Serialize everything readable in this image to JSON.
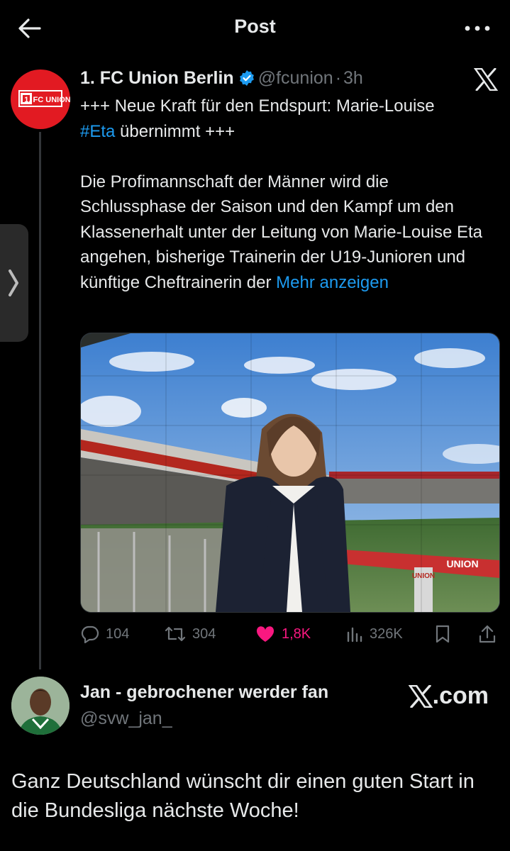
{
  "header": {
    "title": "Post"
  },
  "tweet": {
    "author_name": "1. FC Union Berlin",
    "handle": "@fcunion",
    "separator": "·",
    "time": "3h",
    "line1": "+++ Neue Kraft für den Endspurt: Marie-Louise",
    "hashtag": "#Eta",
    "line2_rest": " übernimmt +++",
    "paragraph": "Die Profimannschaft der Männer wird die Schlussphase der Saison und den Kampf um den Klassenerhalt unter der Leitung von Marie-Louise Eta angehen, bisherige Trainerin der U19-Junioren und künftige Cheftrainerin der",
    "show_more": "Mehr anzeigen",
    "stats": {
      "replies": "104",
      "reposts": "304",
      "likes": "1,8K",
      "views": "326K"
    },
    "avatar_text": "1. FC UNION",
    "banner_text_1": "UNION",
    "banner_text_2": "UNION"
  },
  "reply": {
    "name": "Jan - gebrochener werder fan",
    "handle": "@svw_jan_",
    "brand": ".com",
    "text": "Ganz Deutschland wünscht dir einen guten Start in die Bundesliga nächste Woche!"
  },
  "colors": {
    "accent": "#1d9bf0",
    "like": "#f91880",
    "union_red": "#e21a22"
  }
}
